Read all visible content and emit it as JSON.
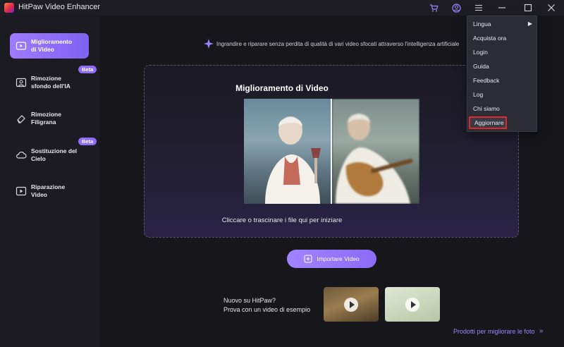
{
  "window": {
    "title": "HitPaw Video Enhancer"
  },
  "sidebar": {
    "items": [
      {
        "label_line1": "Miglioramento",
        "label_line2": "di Video",
        "icon": "video-play-icon",
        "active": true
      },
      {
        "label_line1": "Rimozione",
        "label_line2": "sfondo dell'IA",
        "icon": "portrait-icon",
        "badge": "Beta"
      },
      {
        "label_line1": "Rimozione",
        "label_line2": "Filigrana",
        "icon": "eraser-icon"
      },
      {
        "label_line1": "Sostituzione del",
        "label_line2": "Cielo",
        "icon": "cloud-icon",
        "badge": "Beta"
      },
      {
        "label_line1": "Riparazione",
        "label_line2": "Video",
        "icon": "video-repair-icon"
      }
    ]
  },
  "main": {
    "tagline": "Ingrandire e riparare senza perdita di qualità di vari video sfocati attraverso l'intelligenza artificiale",
    "dropzone_title": "Miglioramento di Video",
    "dropzone_hint": "Cliccare o trascinare i file qui per iniziare",
    "import_label": "Importare Video",
    "sample_line1": "Nuovo su HitPaw?",
    "sample_line2": "Prova con un video di esempio",
    "products_link": "Prodotti per migliorare le foto"
  },
  "menu": {
    "items": [
      "Lingua",
      "Acquista ora",
      "Login",
      "Guida",
      "Feedback",
      "Log",
      "Chi siamo",
      "Aggiornare"
    ]
  },
  "colors": {
    "accent": "#8f6cf5",
    "highlight_border": "#e0262f"
  }
}
